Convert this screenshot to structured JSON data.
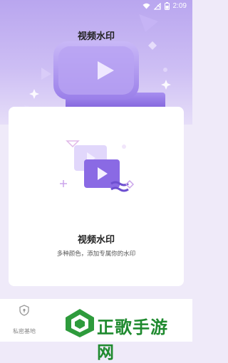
{
  "status_bar": {
    "time": "2:09",
    "battery": ""
  },
  "header": {
    "title": "视频水印"
  },
  "card": {
    "title": "视频水印",
    "description": "多种颜色，添加专属你的水印"
  },
  "bottom_nav": {
    "items": [
      {
        "label": "私密基地",
        "icon": "shield-icon"
      }
    ]
  },
  "watermark": {
    "text": "正歌手游网"
  },
  "colors": {
    "accent": "#8b6ae6",
    "hero_top": "#b9a6ef",
    "logo_green": "#1f8a2f"
  }
}
